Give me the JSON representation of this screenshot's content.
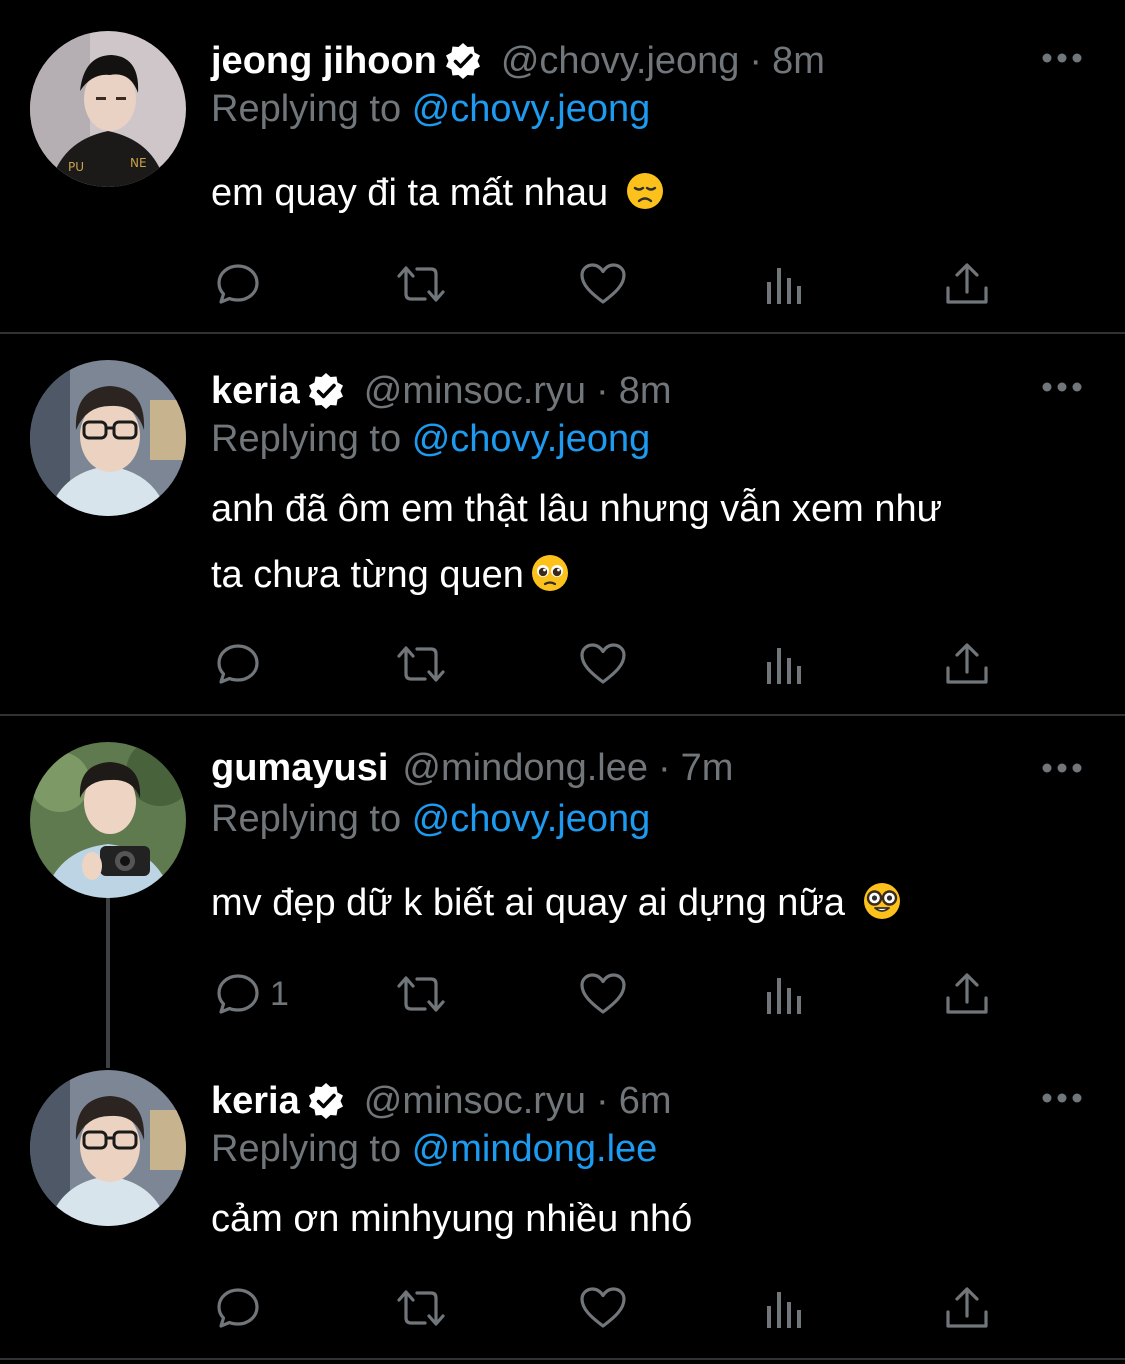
{
  "tweets": [
    {
      "name": "jeong jihoon",
      "handle": "@chovy.jeong",
      "separator": "·",
      "time": "8m",
      "replying_prefix": "Replying to",
      "replying_to": "@chovy.jeong",
      "text": "em quay đi ta mất nhau",
      "emoji": "disappointed-face",
      "reply_count": ""
    },
    {
      "name": "keria",
      "handle": "@minsoc.ryu",
      "separator": "·",
      "time": "8m",
      "replying_prefix": "Replying to",
      "replying_to": "@chovy.jeong",
      "text_line1": "anh đã ôm em thật lâu nhưng vẫn xem như",
      "text_line2": "ta chưa từng quen",
      "emoji": "pleading-face",
      "reply_count": ""
    },
    {
      "name": "gumayusi",
      "handle": "@mindong.lee",
      "separator": "·",
      "time": "7m",
      "replying_prefix": "Replying to",
      "replying_to": "@chovy.jeong",
      "text": "mv đẹp dữ k biết ai quay ai dựng nữa",
      "emoji": "nerd-face",
      "reply_count": "1"
    },
    {
      "name": "keria",
      "handle": "@minsoc.ryu",
      "separator": "·",
      "time": "6m",
      "replying_prefix": "Replying to",
      "replying_to": "@mindong.lee",
      "text": "cảm ơn minhyung nhiều nhó",
      "reply_count": ""
    }
  ],
  "colors": {
    "background": "#000000",
    "text_primary": "#ffffff",
    "text_secondary": "#71767b",
    "link": "#1d9bf0",
    "divider": "#2f3336"
  },
  "icons": {
    "reply": "reply-icon",
    "retweet": "retweet-icon",
    "like": "heart-icon",
    "views": "views-icon",
    "share": "share-icon",
    "more": "more-icon",
    "verified": "verified-badge-icon"
  }
}
